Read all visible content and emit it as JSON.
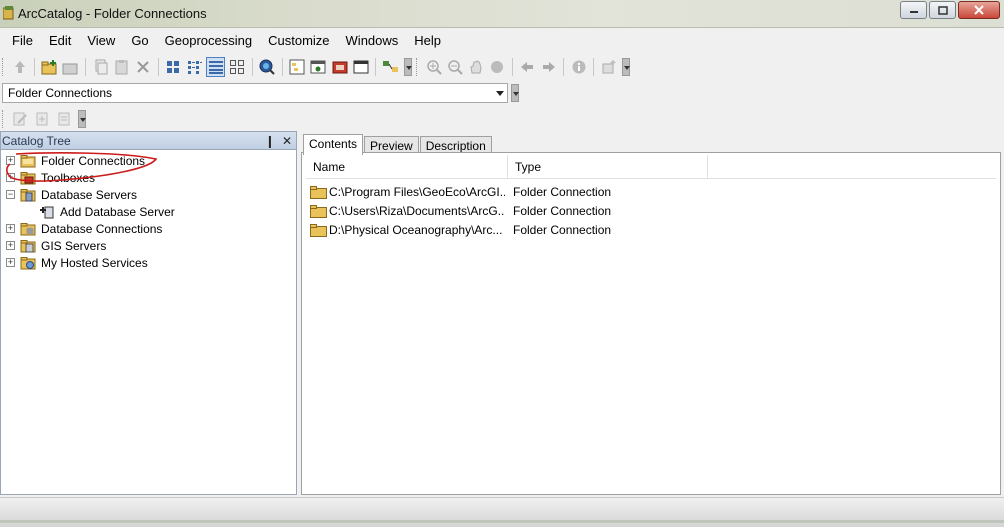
{
  "window": {
    "title": "ArcCatalog - Folder Connections",
    "icon": "arccatalog-icon"
  },
  "menu": [
    "File",
    "Edit",
    "View",
    "Go",
    "Geoprocessing",
    "Customize",
    "Windows",
    "Help"
  ],
  "location": {
    "value": "Folder Connections"
  },
  "catalog_tree": {
    "title": "Catalog Tree",
    "pin_glyph": "❙",
    "close_glyph": "✕",
    "items": [
      {
        "label": "Folder Connections",
        "expander": "+",
        "icon": "folder-connections-icon",
        "indent": 0
      },
      {
        "label": "Toolboxes",
        "expander": "+",
        "icon": "toolbox-icon",
        "indent": 0
      },
      {
        "label": "Database Servers",
        "expander": "−",
        "icon": "database-servers-icon",
        "indent": 0
      },
      {
        "label": "Add Database Server",
        "expander": "",
        "icon": "add-database-server-icon",
        "indent": 1
      },
      {
        "label": "Database Connections",
        "expander": "+",
        "icon": "database-connections-icon",
        "indent": 0
      },
      {
        "label": "GIS Servers",
        "expander": "+",
        "icon": "gis-servers-icon",
        "indent": 0
      },
      {
        "label": "My Hosted Services",
        "expander": "+",
        "icon": "hosted-services-icon",
        "indent": 0
      }
    ]
  },
  "tabs": [
    {
      "label": "Contents",
      "active": true
    },
    {
      "label": "Preview",
      "active": false
    },
    {
      "label": "Description",
      "active": false
    }
  ],
  "contents": {
    "columns": [
      "Name",
      "Type"
    ],
    "rows": [
      {
        "name": "C:\\Program Files\\GeoEco\\ArcGI...",
        "type": "Folder Connection"
      },
      {
        "name": "C:\\Users\\Riza\\Documents\\ArcG...",
        "type": "Folder Connection"
      },
      {
        "name": "D:\\Physical Oceanography\\Arc...",
        "type": "Folder Connection"
      }
    ]
  },
  "colors": {
    "panel_header": "#c8d6ea",
    "annotation": "#cc1b1b",
    "folder": "#e9c25a"
  }
}
